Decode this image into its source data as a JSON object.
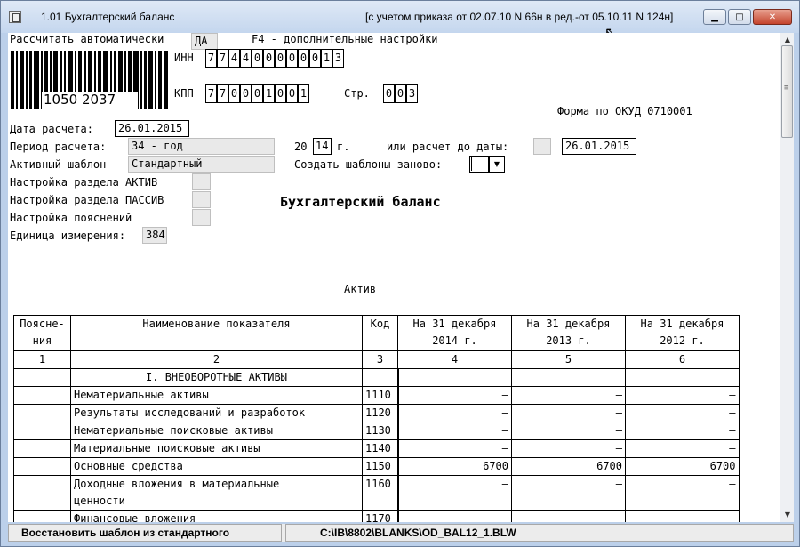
{
  "window": {
    "title_left": "1.01   Бухгалтерский баланс",
    "title_right": "[с учетом приказа от 02.07.10 N 66н в ред.-от 05.10.11 N 124н]",
    "minimize": "▁",
    "maximize": "□",
    "close": "✕"
  },
  "header": {
    "auto_calc_label": "Рассчитать автоматически",
    "auto_calc_value": "ДА",
    "f4_hint": "F4 - дополнительные настройки",
    "barcode_number": "1050 2037",
    "inn_label": "ИНН",
    "inn_digits": [
      "7",
      "7",
      "4",
      "4",
      "0",
      "0",
      "0",
      "0",
      "0",
      "0",
      "1",
      "3"
    ],
    "kpp_label": "КПП",
    "kpp_digits": [
      "7",
      "7",
      "0",
      "0",
      "0",
      "1",
      "0",
      "0",
      "1"
    ],
    "page_label": "Стр.",
    "page_digits": [
      "0",
      "0",
      "3"
    ],
    "okud": "Форма по ОКУД   0710001"
  },
  "settings": {
    "calc_date_label": "Дата расчета:",
    "calc_date": "26.01.2015",
    "period_label": "Период расчета:",
    "period_value": "34 - год",
    "year_prefix": "20",
    "year_value": "14",
    "year_suffix": "г.",
    "calc_to_date_label": "или расчет до даты:",
    "calc_to_date": "26.01.2015",
    "template_label": "Активный шаблон",
    "template_value": "Стандартный",
    "recreate_label": "Создать шаблоны заново:",
    "asset_setup_label": "Настройка раздела АКТИВ",
    "liab_setup_label": "Настройка раздела ПАССИВ",
    "notes_setup_label": "Настройка пояснений",
    "unit_label": "Единица измерения:",
    "unit_value": "384"
  },
  "form_title": "Бухгалтерский баланс",
  "section_title": "Актив",
  "table": {
    "headers": [
      "Пояснения",
      "Наименование показателя",
      "Код",
      "На 31 декабря 2014 г.",
      "На 31 декабря 2013 г.",
      "На 31 декабря 2012 г."
    ],
    "header_lines": [
      [
        "Поясне-",
        "ния"
      ],
      [
        "Наименование показателя"
      ],
      [
        "Код"
      ],
      [
        "На 31 декабря",
        "2014 г."
      ],
      [
        "На 31 декабря",
        "2013 г."
      ],
      [
        "На 31 декабря",
        "2012 г."
      ]
    ],
    "numbers": [
      "1",
      "2",
      "3",
      "4",
      "5",
      "6"
    ],
    "section_row": "I. ВНЕОБОРОТНЫЕ АКТИВЫ",
    "rows": [
      {
        "name": [
          "Нематериальные активы"
        ],
        "code": "1110",
        "v1": "–",
        "v2": "–",
        "v3": "–"
      },
      {
        "name": [
          "Результаты исследований и разработок"
        ],
        "code": "1120",
        "v1": "–",
        "v2": "–",
        "v3": "–"
      },
      {
        "name": [
          "Нематериальные поисковые активы"
        ],
        "code": "1130",
        "v1": "–",
        "v2": "–",
        "v3": "–"
      },
      {
        "name": [
          "Материальные поисковые активы"
        ],
        "code": "1140",
        "v1": "–",
        "v2": "–",
        "v3": "–"
      },
      {
        "name": [
          "Основные средства"
        ],
        "code": "1150",
        "v1": "6700",
        "v2": "6700",
        "v3": "6700"
      },
      {
        "name": [
          "Доходные вложения в материальные",
          "ценности"
        ],
        "code": "1160",
        "v1": "–",
        "v2": "–",
        "v3": "–"
      },
      {
        "name": [
          "Финансовые вложения"
        ],
        "code": "1170",
        "v1": "–",
        "v2": "–",
        "v3": "–"
      }
    ]
  },
  "status": {
    "left": "Восстановить шаблон из стандартного",
    "right": "C:\\IB\\8802\\BLANKS\\OD_BAL12_1.BLW"
  }
}
